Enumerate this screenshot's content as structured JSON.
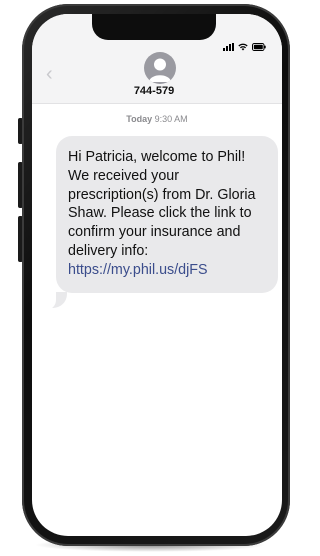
{
  "status_bar": {
    "signal_icon": "signal-bars-icon",
    "wifi_icon": "wifi-icon",
    "battery_icon": "battery-icon"
  },
  "header": {
    "back_icon": "chevron-left-icon",
    "avatar_icon": "person-icon",
    "contact_name": "744-579"
  },
  "conversation": {
    "timestamp_day": "Today",
    "timestamp_time": "9:30 AM",
    "message_text": "Hi Patricia, welcome to Phil! We received your prescription(s) from Dr. Gloria Shaw. Please click the link to confirm your insurance and delivery info:",
    "message_link": "https://my.phil.us/djFS"
  },
  "colors": {
    "bubble_bg": "#e9e9eb",
    "link": "#3b4d8c",
    "header_bg": "#f4f4f5"
  }
}
